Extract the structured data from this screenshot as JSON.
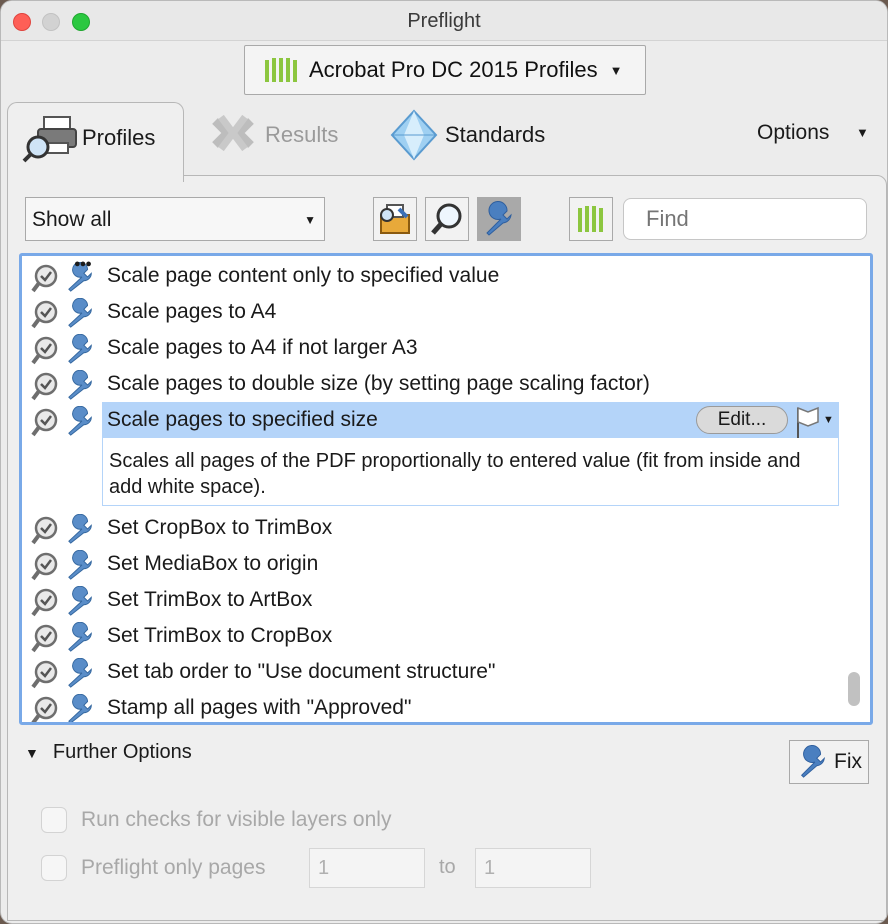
{
  "window": {
    "title": "Preflight"
  },
  "profile_selector": {
    "label": "Acrobat Pro DC 2015 Profiles"
  },
  "tabs": [
    {
      "label": "Profiles",
      "state": "active"
    },
    {
      "label": "Results",
      "state": "disabled"
    },
    {
      "label": "Standards",
      "state": "normal"
    }
  ],
  "options_menu": {
    "label": "Options"
  },
  "toolbar": {
    "filter_value": "Show all",
    "find_placeholder": "Find",
    "icons": [
      "profiles-icon",
      "checks-icon",
      "fixups-icon",
      "library-icon"
    ]
  },
  "fixups": [
    {
      "label": "Scale page content only to specified value"
    },
    {
      "label": "Scale pages to A4"
    },
    {
      "label": "Scale pages to A4 if not larger A3"
    },
    {
      "label": "Scale pages to double size (by setting page scaling factor)"
    },
    {
      "label": "Scale pages to specified size",
      "selected": true
    },
    {
      "label": "Set CropBox to TrimBox"
    },
    {
      "label": "Set MediaBox to origin"
    },
    {
      "label": "Set TrimBox to ArtBox"
    },
    {
      "label": "Set TrimBox to CropBox"
    },
    {
      "label": "Set tab order to \"Use document structure\""
    },
    {
      "label": "Stamp all pages with \"Approved\""
    }
  ],
  "selected_detail": {
    "description": "Scales all pages of the PDF proportionally to entered value (fit from inside and add white space).",
    "edit_label": "Edit..."
  },
  "further_options": {
    "label": "Further Options",
    "fix_label": "Fix",
    "visible_layers_label": "Run checks for visible layers only",
    "pages_label": "Preflight only pages",
    "from_value": "1",
    "to_label": "to",
    "to_value": "1"
  },
  "colors": {
    "accent": "#79a9e8",
    "selection": "#b4d4f9",
    "green": "#8cc63f"
  }
}
